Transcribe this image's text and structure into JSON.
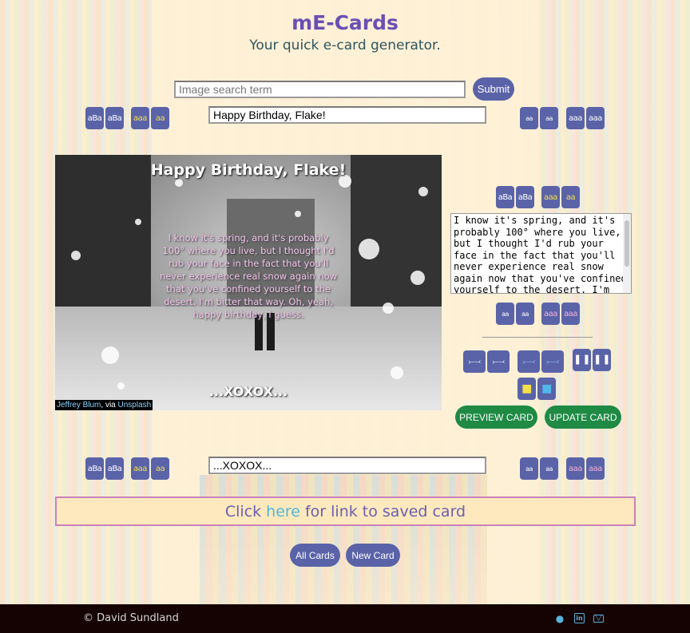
{
  "header": {
    "title": "mE-Cards",
    "subtitle": "Your quick e-card generator."
  },
  "search": {
    "placeholder": "Image search term",
    "value": "",
    "submit_label": "Submit"
  },
  "card": {
    "top_text": "Happy Birthday, Flake!",
    "message": "I know it's spring, and it's probably 100° where you live, but I thought I'd rub your face in the fact that you'll never experience real snow again now that you've confined yourself to the desert. I'm bitter that way. Oh, yeah, happy birthday, I guess.",
    "bottom_text": "...XOXOX...",
    "credit": {
      "author": "Jeffrey Blum",
      "via": ", via ",
      "source": "Unsplash"
    }
  },
  "inputs": {
    "top_value": "Happy Birthday, Flake!",
    "bottom_value": "...XOXOX...",
    "message_value": "I know it's spring, and it's probably 100° where you live, but I thought I'd rub your face in the fact that you'll never experience real snow again now that you've confined yourself to the desert. I'm bitter that way. Oh, yeah, happy birthday, I guess."
  },
  "font_buttons": {
    "font_a": "aBa",
    "font_b": "aBa",
    "color_a": "aaa",
    "color_b": "aa",
    "size_a": "aa",
    "size_b": "aa",
    "case_a": "aaa",
    "case_b": "aaa",
    "align_a": "⤚⤙",
    "align_b": "⤚⤙",
    "valign": "▌▐",
    "box": "■"
  },
  "actions": {
    "preview_label": "PREVIEW CARD",
    "update_label": "UPDATE CARD"
  },
  "link": {
    "prefix": "Click",
    "here": "here",
    "suffix": "for link to saved card"
  },
  "nav": {
    "all_cards": "All Cards",
    "new_card": "New Card"
  },
  "footer": {
    "copyright": "© David Sundland",
    "icons": [
      "github-icon",
      "linkedin-icon",
      "mail-icon"
    ]
  },
  "colors": {
    "title": "#6a4fb3",
    "button": "#5a63a8",
    "green_button": "#1e8a44",
    "footer_bg": "#150303",
    "link_border": "#c981b8"
  }
}
